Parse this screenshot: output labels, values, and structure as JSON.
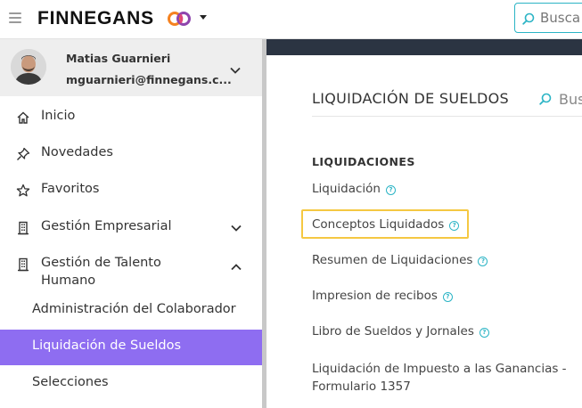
{
  "header": {
    "logo_text": "FINNEGANS",
    "search_placeholder": "Busca",
    "colors": {
      "accent": "#2bb4c5",
      "logo_ring_1": "#f58220",
      "logo_ring_2": "#8e44ad"
    }
  },
  "user": {
    "name": "Matias Guarnieri",
    "email": "mguarnieri@finnegans.c..."
  },
  "sidebar": {
    "items": [
      {
        "label": "Inicio",
        "icon": "home-icon"
      },
      {
        "label": "Novedades",
        "icon": "pin-icon"
      },
      {
        "label": "Favoritos",
        "icon": "star-icon"
      },
      {
        "label": "Gestión Empresarial",
        "icon": "building-icon",
        "expandable": true,
        "expanded": false
      },
      {
        "label": "Gestión de Talento",
        "label_line2": "Humano",
        "icon": "building-icon",
        "expandable": true,
        "expanded": true
      }
    ],
    "subitems": [
      {
        "label": "Administración del Colaborador",
        "active": false
      },
      {
        "label": "Liquidación de Sueldos",
        "active": true
      },
      {
        "label": "Selecciones",
        "active": false
      }
    ],
    "active_color": "#8e6df1"
  },
  "main": {
    "title": "LIQUIDACIÓN DE SUELDOS",
    "search_placeholder": "Bus",
    "section": "LIQUIDACIONES",
    "reports": [
      {
        "label": "Liquidación"
      },
      {
        "label": "Conceptos Liquidados",
        "highlighted": true
      },
      {
        "label": "Resumen de Liquidaciones"
      },
      {
        "label": "Impresion de recibos"
      },
      {
        "label": "Libro de Sueldos y Jornales"
      },
      {
        "label_line1": "Liquidación de Impuesto a las Ganancias -",
        "label_line2": "Formulario 1357"
      }
    ],
    "highlight_color": "#f5c842",
    "band_color": "#2b3442"
  }
}
